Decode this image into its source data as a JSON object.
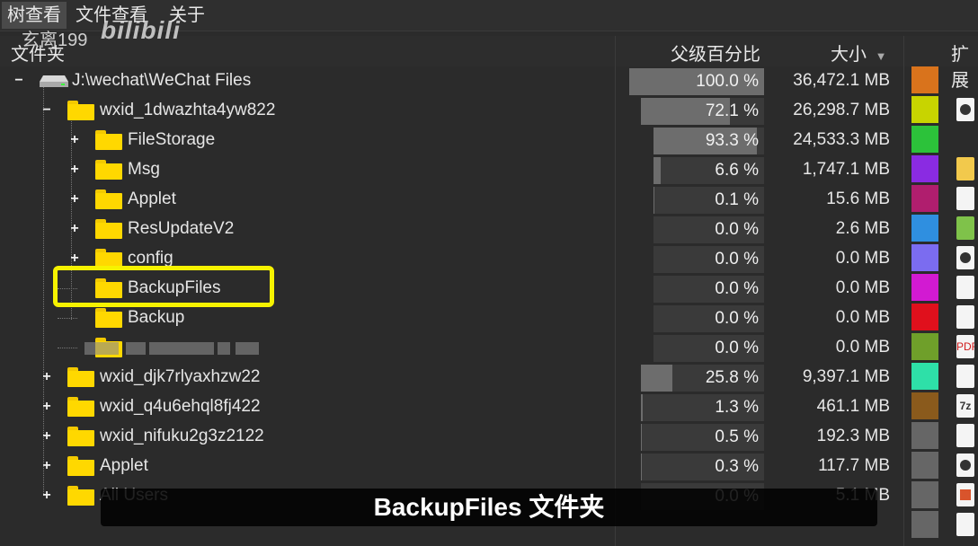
{
  "menu": {
    "tree_view": "树查看",
    "file_view": "文件查看",
    "about": "关于"
  },
  "watermark": {
    "author": "玄离199",
    "logo": "bilibili"
  },
  "columns": {
    "folder": "文件夹",
    "parent_pct": "父级百分比",
    "size": "大小",
    "ext": "扩展"
  },
  "rows": [
    {
      "name": "J:\\wechat\\WeChat Files",
      "pct": "100.0 %",
      "pct_value": 100.0,
      "size": "36,472.1 MB",
      "expander": "−",
      "type": "drive"
    },
    {
      "name": "wxid_1dwazhta4yw822",
      "pct": "72.1 %",
      "pct_value": 72.1,
      "size": "26,298.7 MB",
      "expander": "−",
      "type": "folder"
    },
    {
      "name": "FileStorage",
      "pct": "93.3 %",
      "pct_value": 93.3,
      "size": "24,533.3 MB",
      "expander": "+",
      "type": "folder"
    },
    {
      "name": "Msg",
      "pct": "6.6 %",
      "pct_value": 6.6,
      "size": "1,747.1 MB",
      "expander": "+",
      "type": "folder"
    },
    {
      "name": "Applet",
      "pct": "0.1 %",
      "pct_value": 0.1,
      "size": "15.6 MB",
      "expander": "+",
      "type": "folder"
    },
    {
      "name": "ResUpdateV2",
      "pct": "0.0 %",
      "pct_value": 0.0,
      "size": "2.6 MB",
      "expander": "+",
      "type": "folder"
    },
    {
      "name": "config",
      "pct": "0.0 %",
      "pct_value": 0.0,
      "size": "0.0 MB",
      "expander": "+",
      "type": "folder"
    },
    {
      "name": "BackupFiles",
      "pct": "0.0 %",
      "pct_value": 0.0,
      "size": "0.0 MB",
      "expander": "",
      "type": "folder"
    },
    {
      "name": "Backup",
      "pct": "0.0 %",
      "pct_value": 0.0,
      "size": "0.0 MB",
      "expander": "",
      "type": "folder"
    },
    {
      "name": "",
      "pct": "0.0 %",
      "pct_value": 0.0,
      "size": "0.0 MB",
      "expander": "",
      "type": "folder"
    },
    {
      "name": "wxid_djk7rlyaxhzw22",
      "pct": "25.8 %",
      "pct_value": 25.8,
      "size": "9,397.1 MB",
      "expander": "+",
      "type": "folder"
    },
    {
      "name": "wxid_q4u6ehql8fj422",
      "pct": "1.3 %",
      "pct_value": 1.3,
      "size": "461.1 MB",
      "expander": "+",
      "type": "folder"
    },
    {
      "name": "wxid_nifuku2g3z2122",
      "pct": "0.5 %",
      "pct_value": 0.5,
      "size": "192.3 MB",
      "expander": "+",
      "type": "folder"
    },
    {
      "name": "Applet",
      "pct": "0.3 %",
      "pct_value": 0.3,
      "size": "117.7 MB",
      "expander": "+",
      "type": "folder"
    },
    {
      "name": "All Users",
      "pct": "0.0 %",
      "pct_value": 0.0,
      "size": "5.1 MB",
      "expander": "+",
      "type": "folder"
    }
  ],
  "ext_colors": [
    "#d9731c",
    "#c8d400",
    "#2cc23a",
    "#8a2be2",
    "#b01e6e",
    "#2f8fe0",
    "#7b6cf0",
    "#d21ad2",
    "#e0101c",
    "#6f9f2a",
    "#2ee0a8",
    "#8a5a1c",
    "#666666",
    "#666666",
    "#666666",
    "#666666"
  ],
  "ext_icons": [
    "",
    "video-file-icon",
    "",
    "folder-icon",
    "generic-file-icon",
    "android-icon",
    "video-file-icon",
    "blank-file-icon",
    "window-file-icon",
    "pdf-file-icon",
    "blank-file-icon",
    "7z-file-icon",
    "blank-file-icon",
    "video-file-icon",
    "powerpoint-file-icon",
    "document-file-icon"
  ],
  "ext_icon_text": {
    "pdf": "PDF",
    "sevenz": "7z"
  },
  "subtitle": "BackupFiles 文件夹"
}
